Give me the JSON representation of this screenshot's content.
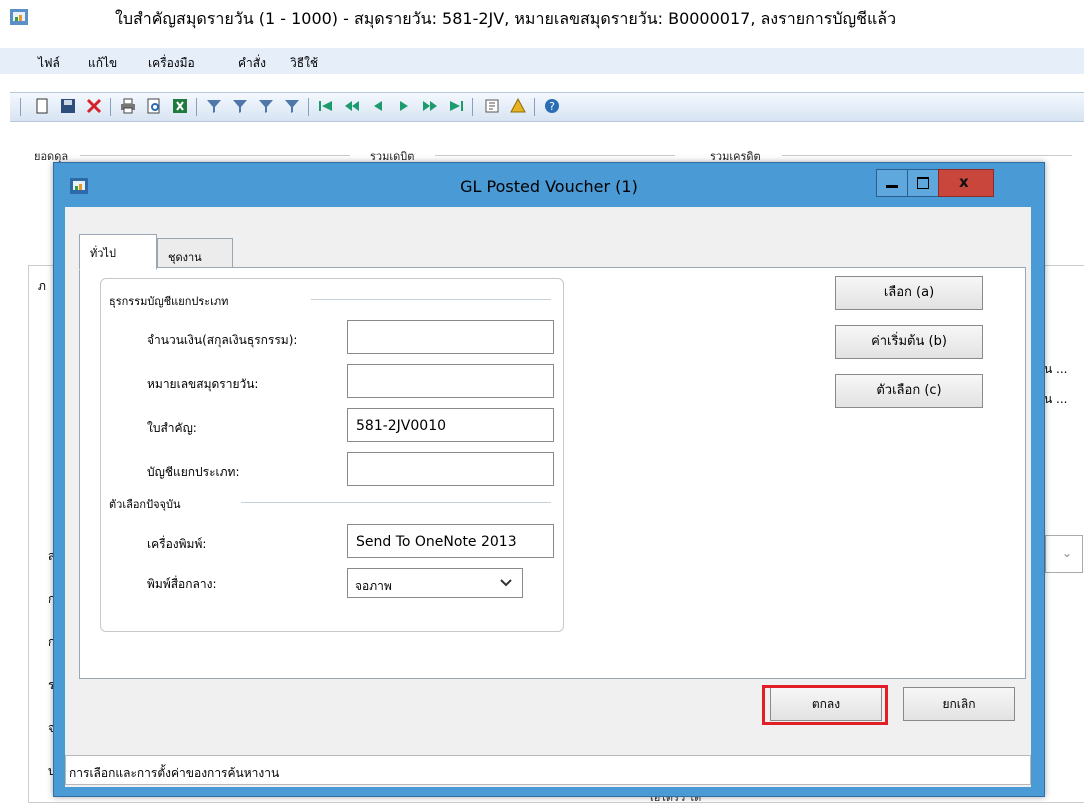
{
  "main_window": {
    "title": "ใบสำคัญสมุดรายวัน (1 - 1000) - สมุดรายวัน: 581-2JV, หมายเลขสมุดรายวัน: B0000017, ลงรายการบัญชีแล้ว",
    "menu": [
      "ไฟล์",
      "แก้ไข",
      "เครื่องมือ",
      "คำสั่ง",
      "วิธีใช้"
    ],
    "group_labels": [
      "ยอดดุล",
      "รวมเดบิต",
      "รวมเครดิต"
    ],
    "side_fragment": "ภ",
    "right_fragments": [
      "น ...",
      "น ..."
    ],
    "left_fragments": [
      "ส",
      "ก",
      "ก",
      "ร",
      "จ",
      "บ"
    ],
    "bottom_fragment": "เอ่ได้รว ได้"
  },
  "dialog": {
    "title": "GL Posted Voucher (1)",
    "tabs": [
      {
        "label": "ทั่วไป"
      },
      {
        "label": "ชุดงาน"
      }
    ],
    "group1_label": "ธุรกรรมบัญชีแยกประเภท",
    "fields1": [
      {
        "label": "จำนวนเงิน(สกุลเงินธุรกรรม):",
        "value": ""
      },
      {
        "label": "หมายเลขสมุดรายวัน:",
        "value": ""
      },
      {
        "label": "ใบสำคัญ:",
        "value": "581-2JV0010"
      },
      {
        "label": "บัญชีแยกประเภท:",
        "value": ""
      }
    ],
    "group2_label": "ตัวเลือกปัจจุบัน",
    "printer": {
      "label": "เครื่องพิมพ์:",
      "value": "Send To OneNote 2013"
    },
    "print_medium": {
      "label": "พิมพ์สื่อกลาง:",
      "value": "จอภาพ"
    },
    "side_buttons": [
      "เลือก (a)",
      "ค่าเริ่มต้น (b)",
      "ตัวเลือก (c)"
    ],
    "ok_label": "ตกลง",
    "cancel_label": "ยกเลิก",
    "status_text": "การเลือกและการตั้งค่าของการค้นหางาน"
  },
  "colors": {
    "dialog_frame": "#4a9ad6",
    "close_button": "#c9463d",
    "highlight": "#e21f26"
  }
}
